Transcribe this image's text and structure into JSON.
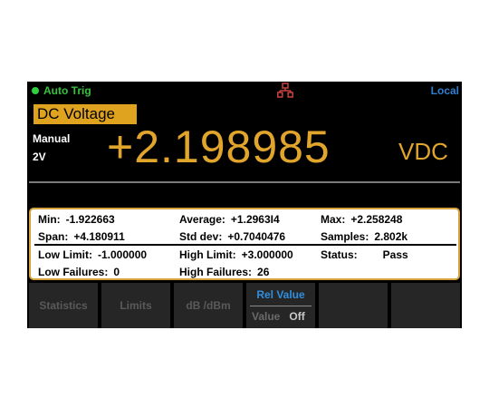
{
  "status": {
    "trigger": "Auto Trig",
    "remote": "Local",
    "colors": {
      "trigger": "#35c23c",
      "remote": "#2f7fd0"
    }
  },
  "measurement": {
    "function": "DC Voltage",
    "range_mode": "Manual",
    "range": "2V",
    "reading": "+2.198985",
    "unit": "VDC",
    "accent": "#e2a52c"
  },
  "stats": {
    "min_label": "Min:",
    "min": "-1.922663",
    "average_label": "Average:",
    "average": "+1.2963I4",
    "max_label": "Max:",
    "max": "+2.258248",
    "span_label": "Span:",
    "span": "+4.180911",
    "stddev_label": "Std dev:",
    "stddev": "+0.7040476",
    "samples_label": "Samples:",
    "samples": "2.802k",
    "low_limit_label": "Low Limit:",
    "low_limit": "-1.000000",
    "high_limit_label": "High Limit:",
    "high_limit": "+3.000000",
    "status_label": "Status:",
    "status": "Pass",
    "low_failures_label": "Low Failures:",
    "low_failures": "0",
    "high_failures_label": "High Failures:",
    "high_failures": "26"
  },
  "softkeys": {
    "statistics": "Statistics",
    "limits": "Limits",
    "db": "dB /dBm",
    "rel_title": "Rel Value",
    "rel_label": "Value",
    "rel_state": "Off"
  }
}
